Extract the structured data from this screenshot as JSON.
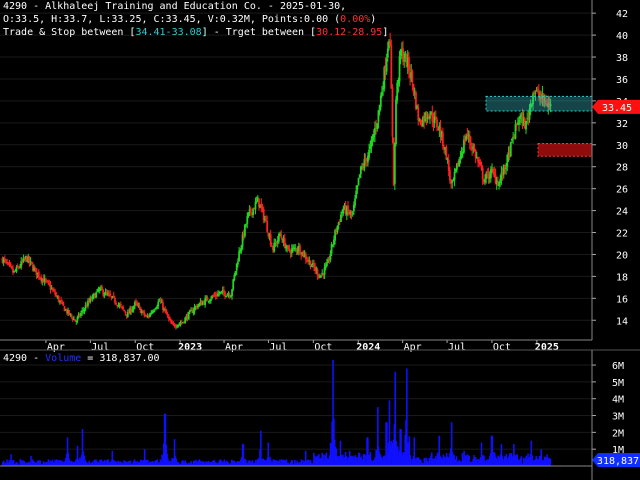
{
  "header": {
    "line1": "4290 - Alkhaleej Training and Education Co. - 2025-01-30,",
    "line2_prefix": "O:33.5, H:33.7, L:33.25, C:33.45, V:0.32M, Points:0.00 (",
    "line2_pct": "0.00%",
    "line2_suffix": ")",
    "line3_a": "Trade & Stop between [",
    "line3_stop": "34.41-33.08",
    "line3_b": "] - Trget between [",
    "line3_tgt": "30.12-28.95",
    "line3_c": "]"
  },
  "volume_header": {
    "prefix": "4290 - ",
    "name": "Volume",
    "suffix": " = 318,837.00"
  },
  "colors": {
    "up": "#22d622",
    "down": "#ff2020",
    "volume": "#1010ff",
    "stop_zone": "#35c8d0",
    "target_zone": "#c01010",
    "last_price_tag": "#ff1010",
    "last_volume_tag": "#1030ff"
  },
  "chart_data": [
    {
      "type": "candlestick",
      "y_ticks": [
        14,
        16,
        18,
        20,
        22,
        24,
        26,
        28,
        30,
        32,
        34,
        36,
        38,
        40,
        42
      ],
      "ylim": [
        12.2,
        43.2
      ],
      "x_tick_labels": [
        "Apr",
        "Jul",
        "Oct",
        "2023",
        "Apr",
        "Jul",
        "Oct",
        "2024",
        "Apr",
        "Jul",
        "Oct",
        "2025"
      ],
      "price_path": [
        [
          "2022-01-02",
          19.6
        ],
        [
          "2022-01-25",
          18.3
        ],
        [
          "2022-02-20",
          19.7
        ],
        [
          "2022-03-10",
          18.5
        ],
        [
          "2022-04-10",
          17.0
        ],
        [
          "2022-05-10",
          15.0
        ],
        [
          "2022-06-01",
          13.9
        ],
        [
          "2022-06-25",
          15.5
        ],
        [
          "2022-07-20",
          16.8
        ],
        [
          "2022-08-20",
          15.8
        ],
        [
          "2022-09-15",
          14.5
        ],
        [
          "2022-10-01",
          15.5
        ],
        [
          "2022-10-25",
          14.2
        ],
        [
          "2022-11-20",
          15.8
        ],
        [
          "2022-12-15",
          13.5
        ],
        [
          "2023-01-05",
          13.8
        ],
        [
          "2023-02-01",
          15.2
        ],
        [
          "2023-03-01",
          16.0
        ],
        [
          "2023-03-25",
          16.5
        ],
        [
          "2023-04-15",
          16.4
        ],
        [
          "2023-05-01",
          20.0
        ],
        [
          "2023-05-20",
          23.5
        ],
        [
          "2023-06-10",
          24.9
        ],
        [
          "2023-06-25",
          23.0
        ],
        [
          "2023-07-10",
          20.5
        ],
        [
          "2023-07-25",
          21.8
        ],
        [
          "2023-08-10",
          20.3
        ],
        [
          "2023-09-01",
          20.6
        ],
        [
          "2023-09-25",
          19.2
        ],
        [
          "2023-10-15",
          18.0
        ],
        [
          "2023-10-30",
          19.0
        ],
        [
          "2023-11-15",
          22.0
        ],
        [
          "2023-12-01",
          24.2
        ],
        [
          "2023-12-20",
          23.5
        ],
        [
          "2024-01-05",
          27.5
        ],
        [
          "2024-01-25",
          29.5
        ],
        [
          "2024-02-10",
          32.5
        ],
        [
          "2024-02-25",
          37.0
        ],
        [
          "2024-03-05",
          40.5
        ],
        [
          "2024-03-10",
          33.0
        ],
        [
          "2024-03-14",
          26.0
        ],
        [
          "2024-03-18",
          34.0
        ],
        [
          "2024-03-28",
          38.5
        ],
        [
          "2024-04-10",
          37.5
        ],
        [
          "2024-04-20",
          36.0
        ],
        [
          "2024-05-05",
          32.0
        ],
        [
          "2024-05-25",
          33.0
        ],
        [
          "2024-06-15",
          31.5
        ],
        [
          "2024-06-30",
          29.0
        ],
        [
          "2024-07-10",
          26.0
        ],
        [
          "2024-07-25",
          28.5
        ],
        [
          "2024-08-10",
          31.0
        ],
        [
          "2024-08-25",
          29.5
        ],
        [
          "2024-09-15",
          26.8
        ],
        [
          "2024-09-30",
          27.5
        ],
        [
          "2024-10-15",
          26.5
        ],
        [
          "2024-11-01",
          28.5
        ],
        [
          "2024-11-10",
          30.0
        ],
        [
          "2024-11-25",
          32.5
        ],
        [
          "2024-12-10",
          31.8
        ],
        [
          "2024-12-25",
          35.0
        ],
        [
          "2025-01-10",
          34.2
        ],
        [
          "2025-01-30",
          33.45
        ]
      ],
      "last_price": "33.45",
      "zones": [
        {
          "name": "Trade & Stop",
          "range": [
            33.08,
            34.41
          ],
          "start": "2024-12-24"
        },
        {
          "name": "Target",
          "range": [
            28.95,
            30.12
          ],
          "start": "2025-01-08"
        }
      ]
    },
    {
      "type": "bar",
      "series_name": "Volume",
      "y_ticks": [
        "1M",
        "2M",
        "3M",
        "4M",
        "5M",
        "6M"
      ],
      "ylim": [
        0,
        6300000
      ],
      "last_volume": "318,837",
      "spikes": [
        [
          "2022-01-20",
          700000
        ],
        [
          "2022-03-01",
          600000
        ],
        [
          "2022-05-15",
          1700000
        ],
        [
          "2022-06-05",
          1200000
        ],
        [
          "2022-06-15",
          2200000
        ],
        [
          "2022-08-15",
          900000
        ],
        [
          "2022-10-20",
          1000000
        ],
        [
          "2022-12-01",
          3100000
        ],
        [
          "2022-12-20",
          1600000
        ],
        [
          "2023-05-10",
          1300000
        ],
        [
          "2023-06-15",
          2100000
        ],
        [
          "2023-07-01",
          1400000
        ],
        [
          "2023-09-15",
          900000
        ],
        [
          "2023-11-10",
          6300000
        ],
        [
          "2023-11-25",
          1500000
        ],
        [
          "2023-12-15",
          900000
        ],
        [
          "2024-01-20",
          1700000
        ],
        [
          "2024-02-10",
          3500000
        ],
        [
          "2024-02-28",
          2600000
        ],
        [
          "2024-03-05",
          3900000
        ],
        [
          "2024-03-12",
          1400000
        ],
        [
          "2024-03-17",
          5600000
        ],
        [
          "2024-03-28",
          2200000
        ],
        [
          "2024-04-10",
          5800000
        ],
        [
          "2024-04-25",
          1700000
        ],
        [
          "2024-06-15",
          1800000
        ],
        [
          "2024-07-10",
          2600000
        ],
        [
          "2024-08-05",
          900000
        ],
        [
          "2024-09-10",
          1400000
        ],
        [
          "2024-10-01",
          1800000
        ],
        [
          "2024-10-20",
          1300000
        ],
        [
          "2024-11-15",
          1300000
        ],
        [
          "2024-12-20",
          1500000
        ],
        [
          "2025-01-10",
          1000000
        ]
      ]
    }
  ]
}
